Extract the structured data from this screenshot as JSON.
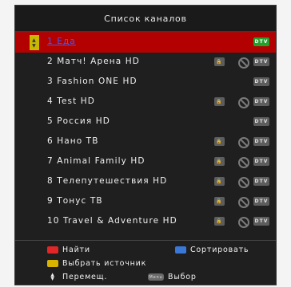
{
  "header": {
    "title": "Список каналов"
  },
  "channels": [
    {
      "label": "1 Еда",
      "lock": false,
      "skip": false,
      "type": "DTV",
      "selected": true
    },
    {
      "label": "2 Матч! Арена HD",
      "lock": true,
      "skip": true,
      "type": "DTV"
    },
    {
      "label": "3 Fashion ONE HD",
      "lock": false,
      "skip": false,
      "type": "DTV"
    },
    {
      "label": "4 Test HD",
      "lock": true,
      "skip": true,
      "type": "DTV"
    },
    {
      "label": "5 Россия HD",
      "lock": false,
      "skip": false,
      "type": "DTV"
    },
    {
      "label": "6 Нано ТВ",
      "lock": true,
      "skip": true,
      "type": "DTV"
    },
    {
      "label": "7 Animal Family HD",
      "lock": true,
      "skip": true,
      "type": "DTV"
    },
    {
      "label": "8 Телепутешествия HD",
      "lock": true,
      "skip": true,
      "type": "DTV"
    },
    {
      "label": "9 Тонус ТВ",
      "lock": true,
      "skip": true,
      "type": "DTV"
    },
    {
      "label": "10 Travel & Adventure HD",
      "lock": true,
      "skip": true,
      "type": "DTV"
    }
  ],
  "footer": {
    "find": "Найти",
    "sort": "Сортировать",
    "source": "Выбрать источник",
    "move": "Перемещ.",
    "menu_key": "Menu",
    "select": "Выбор"
  },
  "colors": {
    "selected_row": "#b30000",
    "dtv_active": "#22a12b",
    "red_key": "#e02626",
    "blue_key": "#3a78d8",
    "yellow_key": "#d8b400"
  }
}
